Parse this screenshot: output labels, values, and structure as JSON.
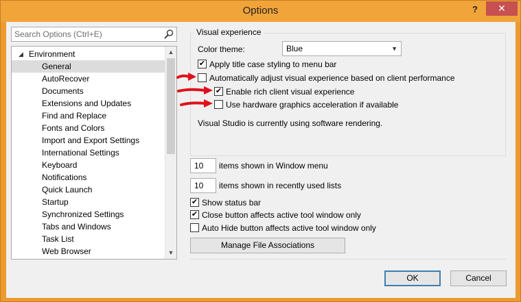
{
  "window": {
    "title": "Options",
    "help_glyph": "?",
    "close_glyph": "✕"
  },
  "search": {
    "placeholder": "Search Options (Ctrl+E)"
  },
  "tree": {
    "root": "Environment",
    "items": [
      "General",
      "AutoRecover",
      "Documents",
      "Extensions and Updates",
      "Find and Replace",
      "Fonts and Colors",
      "Import and Export Settings",
      "International Settings",
      "Keyboard",
      "Notifications",
      "Quick Launch",
      "Startup",
      "Synchronized Settings",
      "Tabs and Windows",
      "Task List",
      "Web Browser"
    ],
    "selected": "General"
  },
  "visual": {
    "group_label": "Visual experience",
    "color_theme_label": "Color theme:",
    "color_theme_value": "Blue",
    "apply_title_case": {
      "label": "Apply title case styling to menu bar",
      "checked": true
    },
    "auto_adjust": {
      "label": "Automatically adjust visual experience based on client performance",
      "checked": false
    },
    "rich_client": {
      "label": "Enable rich client visual experience",
      "checked": true
    },
    "hw_accel": {
      "label": "Use hardware graphics acceleration if available",
      "checked": false
    },
    "status_text": "Visual Studio is currently using software rendering."
  },
  "window_menu": {
    "value": "10",
    "label": "items shown in Window menu"
  },
  "recent_lists": {
    "value": "10",
    "label": "items shown in recently used lists"
  },
  "show_status_bar": {
    "label": "Show status bar",
    "checked": true
  },
  "close_button": {
    "label": "Close button affects active tool window only",
    "checked": true
  },
  "auto_hide": {
    "label": "Auto Hide button affects active tool window only",
    "checked": false
  },
  "manage_file_assoc": "Manage File Associations",
  "buttons": {
    "ok": "OK",
    "cancel": "Cancel"
  },
  "check_glyph": "✔",
  "colors": {
    "titlebar": "#f0a43a",
    "close": "#c75050",
    "annotation_arrow": "#e0101a"
  }
}
